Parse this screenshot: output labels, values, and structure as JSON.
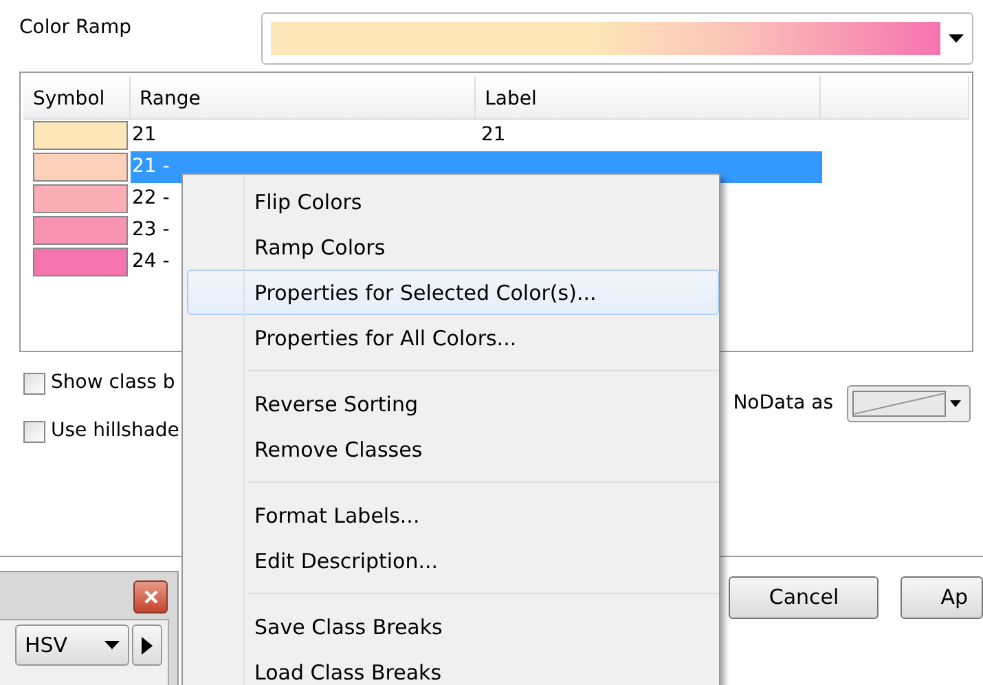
{
  "color_ramp": {
    "label": "Color Ramp"
  },
  "table": {
    "columns": [
      "Symbol",
      "Range",
      "Label"
    ],
    "rows": [
      {
        "color": "#fde6b8",
        "range": "21",
        "label": "21",
        "selected": false
      },
      {
        "color": "#fdd0b9",
        "range": "21 -",
        "selected": true
      },
      {
        "color": "#fbadb6",
        "range": "22 -",
        "selected": false
      },
      {
        "color": "#f893b3",
        "range": "23 -",
        "selected": false
      },
      {
        "color": "#f574ae",
        "range": "24 -",
        "selected": false
      }
    ]
  },
  "checkboxes": [
    {
      "label": "Show class b",
      "checked": false
    },
    {
      "label": "Use hillshade",
      "checked": false
    }
  ],
  "nodata": {
    "label": "NoData as"
  },
  "buttons": [
    "Cancel",
    "Ap"
  ],
  "context_menu": {
    "groups": [
      [
        {
          "label": "Flip Colors",
          "selected": false
        },
        {
          "label": "Ramp Colors",
          "selected": false
        },
        {
          "label": "Properties for Selected Color(s)...",
          "selected": true
        },
        {
          "label": "Properties for All Colors...",
          "selected": false
        }
      ],
      [
        {
          "label": "Reverse Sorting",
          "selected": false
        },
        {
          "label": "Remove Classes",
          "selected": false
        }
      ],
      [
        {
          "label": "Format Labels...",
          "selected": false
        },
        {
          "label": "Edit Description...",
          "selected": false
        }
      ],
      [
        {
          "label": "Save Class Breaks",
          "selected": false
        },
        {
          "label": "Load Class Breaks",
          "selected": false
        }
      ]
    ]
  },
  "small_window": {
    "combo": "HSV"
  }
}
